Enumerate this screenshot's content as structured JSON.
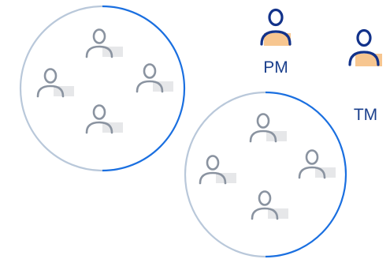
{
  "diagram": {
    "colors": {
      "ring_left_half": "#b9c8da",
      "ring_right_half": "#1a6fe0",
      "member_icon": "#8a93a0",
      "member_highlight": "#e6e7e9",
      "role_icon": "#12328a",
      "role_highlight": "#f7c690",
      "role_label": "#1a3f8c"
    },
    "icons": {
      "member": "person-icon",
      "role": "person-icon"
    },
    "teams": [
      {
        "name": "team-1",
        "member_count": 4
      },
      {
        "name": "team-2",
        "member_count": 4
      }
    ],
    "roles": [
      {
        "label": "PM"
      },
      {
        "label": "TM"
      }
    ]
  }
}
